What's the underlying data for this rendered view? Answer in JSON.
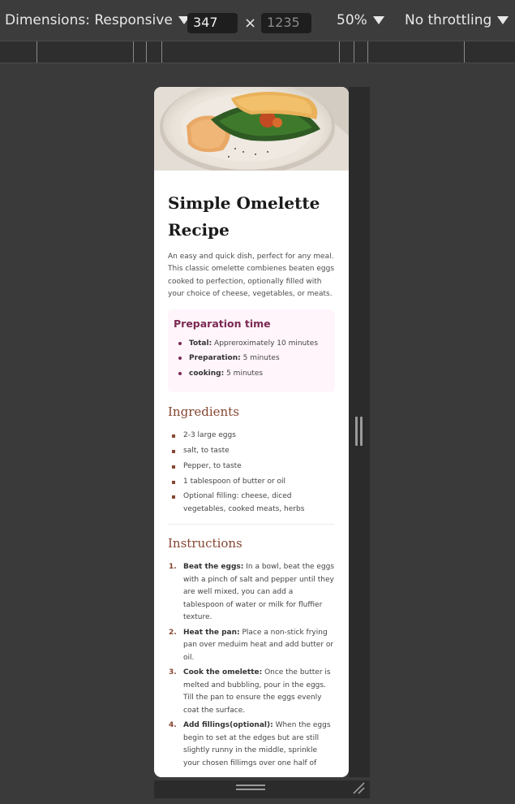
{
  "toolbar": {
    "dimensions_label": "Dimensions: Responsive",
    "width_value": "347",
    "height_placeholder": "1235",
    "times": "×",
    "zoom": "50%",
    "throttling": "No throttling"
  },
  "recipe": {
    "title": "Simple Omelette Recipe",
    "intro": "An easy and quick dish, perfect for any meal. This classic omelette combienes beaten eggs cooked to perfection, optionally filled with your choice of cheese, vegetables, or meats.",
    "prep": {
      "heading": "Preparation time",
      "items": [
        {
          "label": "Total:",
          "value": " Appreroximately 10 minutes"
        },
        {
          "label": "Preparation:",
          "value": " 5 minutes"
        },
        {
          "label": "cooking:",
          "value": " 5 minutes"
        }
      ]
    },
    "ingredients": {
      "heading": "Ingredients",
      "items": [
        "2-3 large eggs",
        "salt, to taste",
        "Pepper, to taste",
        "1 tablespoon of butter or oil",
        "Optional filling: cheese, diced vegetables, cooked meats, herbs"
      ]
    },
    "instructions": {
      "heading": "Instructions",
      "steps": [
        {
          "num": "1.",
          "label": "Beat the eggs:",
          "text": " In a bowl, beat the eggs with a pinch of salt and pepper until they are well mixed, you can add a tablespoon of water or milk for fluffier texture."
        },
        {
          "num": "2.",
          "label": "Heat the pan:",
          "text": " Place a non-stick frying pan over meduim heat and add butter or oil."
        },
        {
          "num": "3.",
          "label": "Cook the omelette:",
          "text": " Once the butter is melted and bubbling, pour in the eggs. Till the pan to ensure the eggs evenly coat the surface."
        },
        {
          "num": "4.",
          "label": "Add fillings(optional):",
          "text": " When the eggs begin to set at the edges but are still slightly runny in the middle, sprinkle your chosen fillimgs over one half of"
        }
      ]
    }
  }
}
